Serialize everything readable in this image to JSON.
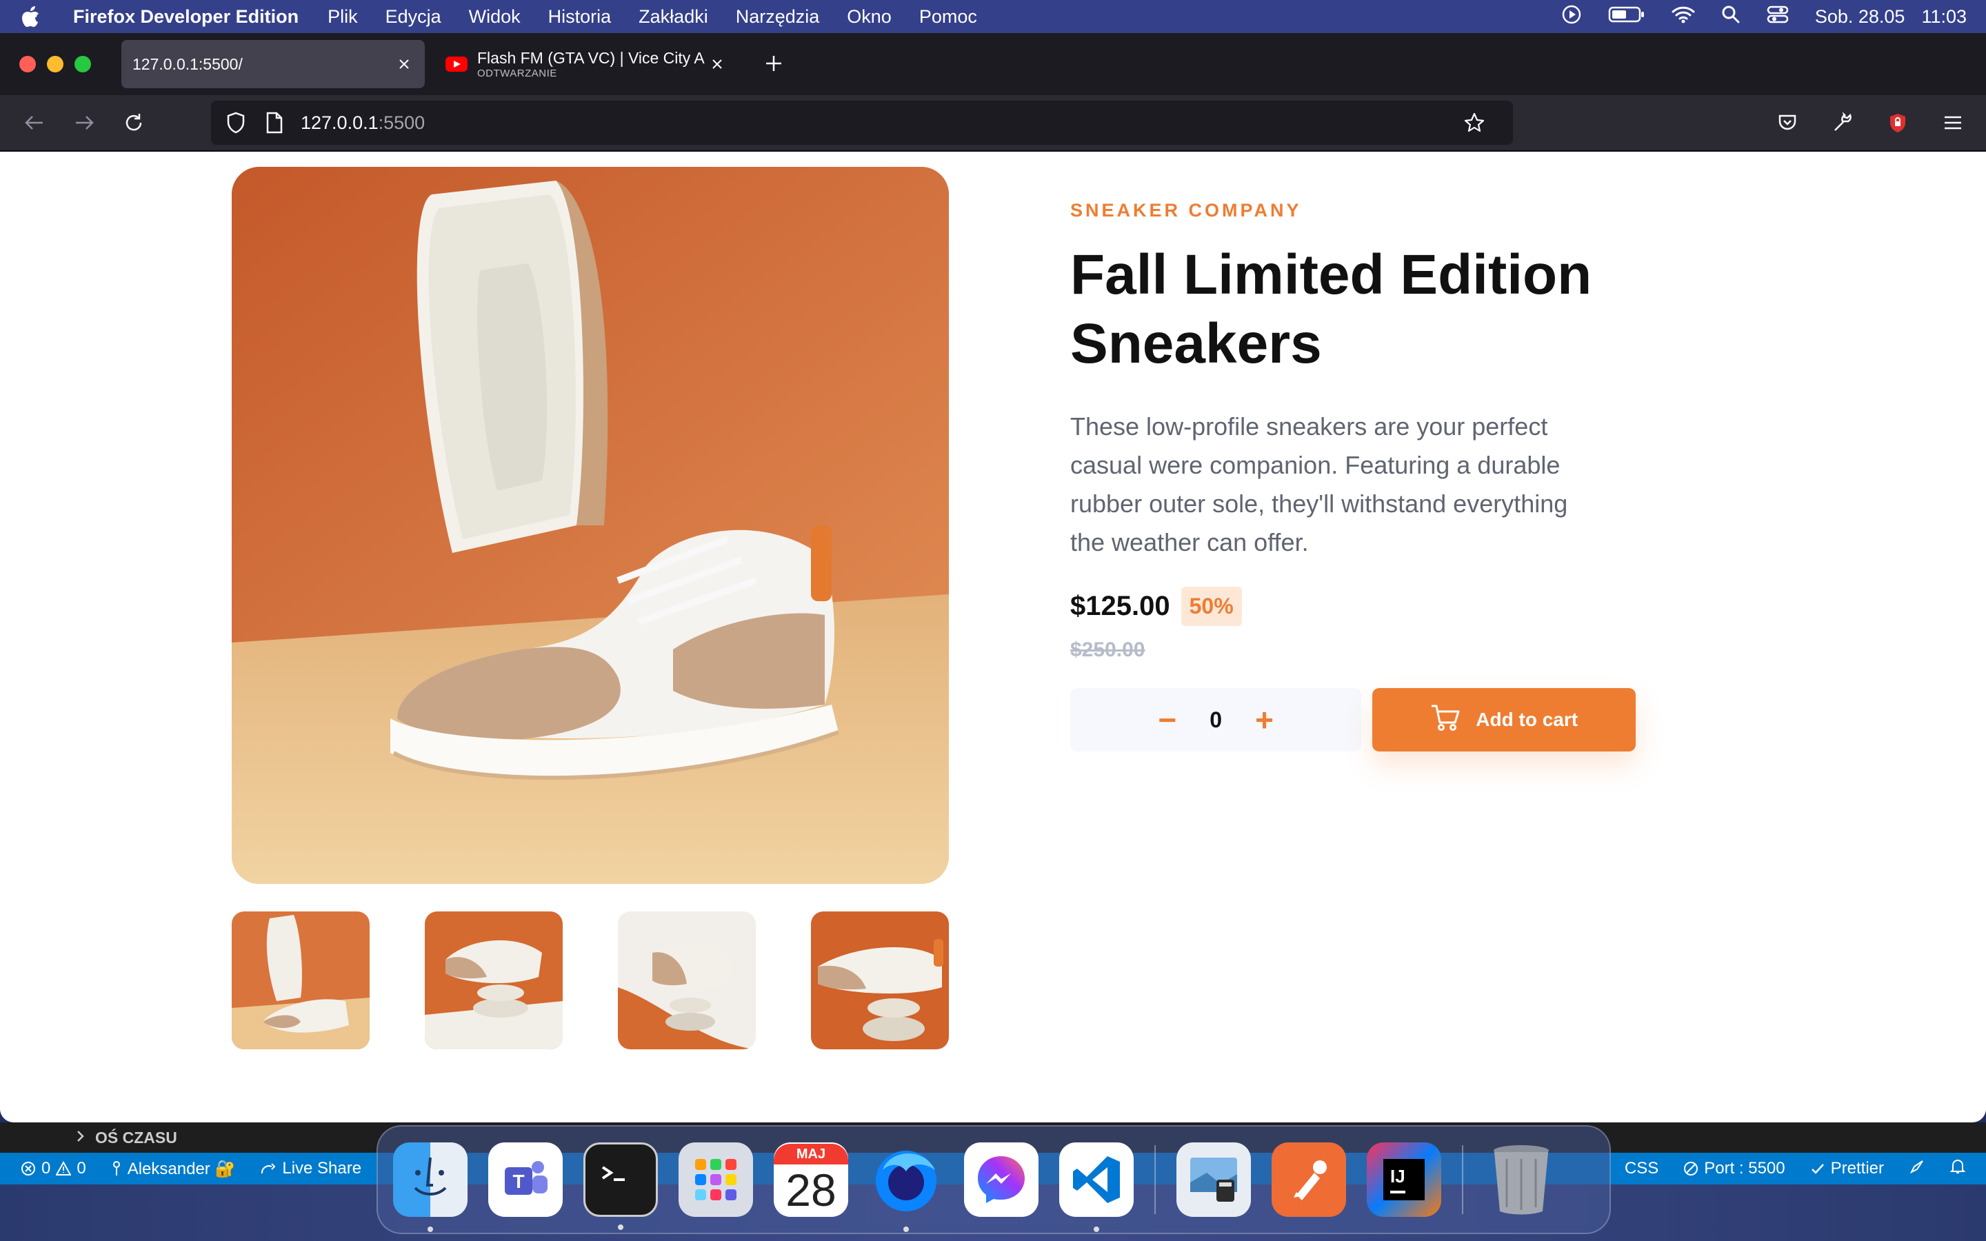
{
  "menubar": {
    "app_name": "Firefox Developer Edition",
    "items": [
      "Plik",
      "Edycja",
      "Widok",
      "Historia",
      "Zakładki",
      "Narzędzia",
      "Okno",
      "Pomoc"
    ],
    "date": "Sob. 28.05",
    "time": "11:03"
  },
  "browser": {
    "tabs": [
      {
        "title": "127.0.0.1:5500/",
        "subtitle": ""
      },
      {
        "title": "Flash FM (GTA VC) | Vice City Ar",
        "subtitle": "ODTWARZANIE"
      }
    ],
    "url_host": "127.0.0.1",
    "url_port": ":5500"
  },
  "product": {
    "company": "SNEAKER COMPANY",
    "title_line1": "Fall Limited Edition",
    "title_line2": "Sneakers",
    "description": "These low-profile sneakers are your perfect casual were companion. Featuring a durable rubber outer sole, they'll withstand everything the weather can offer.",
    "price": "$125.00",
    "discount": "50%",
    "old_price": "$250.00",
    "quantity": "0",
    "minus_label": "−",
    "plus_label": "+",
    "add_to_cart": "Add to cart"
  },
  "vscode": {
    "timeline": "OŚ CZASU",
    "errors": "0",
    "warnings": "0",
    "user": "Aleksander 🔐",
    "live_share": "Live Share",
    "css": "CSS",
    "port": "Port : 5500",
    "prettier": "Prettier"
  },
  "dock": {
    "calendar_month": "MAJ",
    "calendar_day": "28"
  },
  "colors": {
    "accent": "#ee7d32",
    "accent_pale": "#fde8d8",
    "statusbar": "#007acc"
  }
}
